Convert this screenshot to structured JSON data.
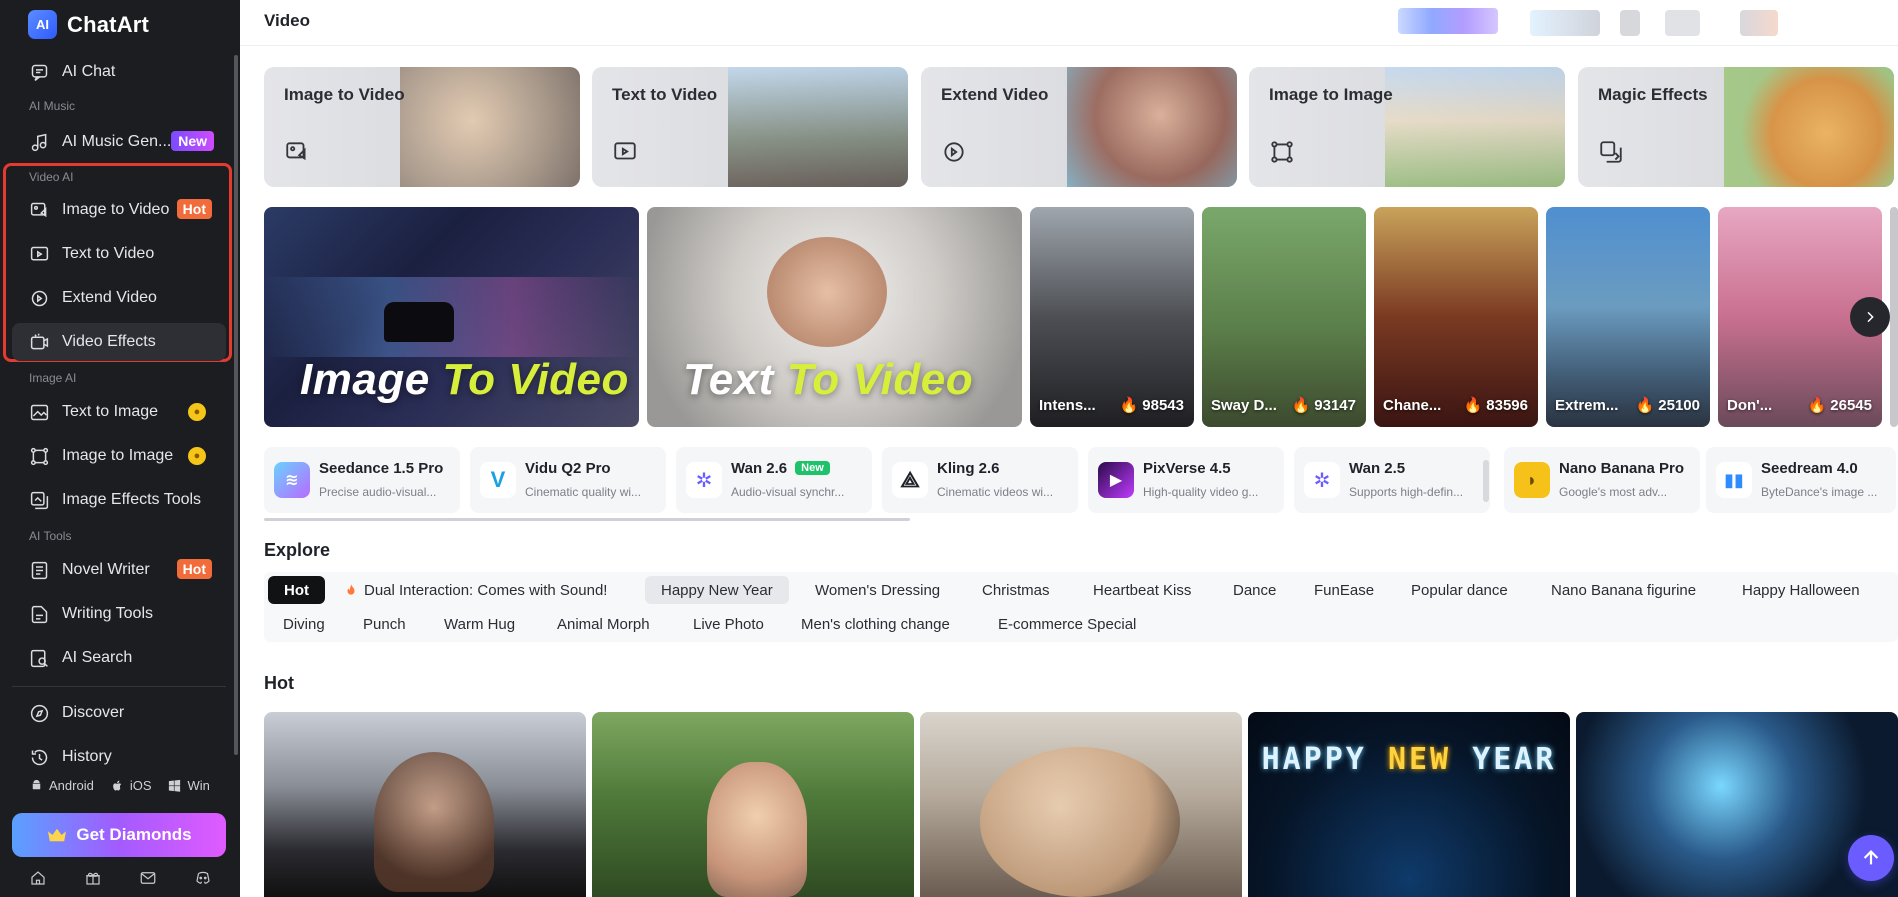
{
  "brand": {
    "logo_text": "AI",
    "name": "ChatArt"
  },
  "sidebar": {
    "items": [
      {
        "label": "AI Chat"
      },
      {
        "label": "AI Music Gen...",
        "badge": "New"
      },
      {
        "label": "Image to Video",
        "badge": "Hot"
      },
      {
        "label": "Text to Video"
      },
      {
        "label": "Extend Video"
      },
      {
        "label": "Video Effects"
      },
      {
        "label": "Text to Image"
      },
      {
        "label": "Image to Image"
      },
      {
        "label": "Image Effects Tools"
      },
      {
        "label": "Novel Writer",
        "badge": "Hot"
      },
      {
        "label": "Writing Tools"
      },
      {
        "label": "AI Search"
      },
      {
        "label": "Discover"
      },
      {
        "label": "History"
      }
    ],
    "sections": {
      "music": "AI Music",
      "video": "Video AI",
      "image": "Image AI",
      "tools": "AI Tools"
    },
    "platforms": {
      "android": "Android",
      "ios": "iOS",
      "win": "Win"
    },
    "cta": "Get Diamonds"
  },
  "header": {
    "title": "Video"
  },
  "features": [
    {
      "label": "Image to Video"
    },
    {
      "label": "Text to Video"
    },
    {
      "label": "Extend Video"
    },
    {
      "label": "Image to Image"
    },
    {
      "label": "Magic Effects"
    }
  ],
  "banners": [
    {
      "part1": "Image ",
      "part2": "To Video"
    },
    {
      "part1": "Text ",
      "part2": "To Video"
    }
  ],
  "effects": [
    {
      "name": "Intens...",
      "count": "🔥 98543"
    },
    {
      "name": "Sway D...",
      "count": "🔥 93147"
    },
    {
      "name": "Chane...",
      "count": "🔥 83596"
    },
    {
      "name": "Extrem...",
      "count": "🔥 25100"
    },
    {
      "name": "Don'...",
      "count": "🔥 26545"
    }
  ],
  "models": [
    {
      "name": "Seedance 1.5 Pro",
      "desc": "Precise audio-visual...",
      "color": "#8a5cff"
    },
    {
      "name": "Vidu Q2 Pro",
      "desc": "Cinematic quality wi...",
      "color": "#1aa0e6"
    },
    {
      "name": "Wan 2.6",
      "badge": "New",
      "desc": "Audio-visual synchr...",
      "color": "#6a5cff"
    },
    {
      "name": "Kling 2.6",
      "desc": "Cinematic videos wi...",
      "color": "#1f2329"
    },
    {
      "name": "PixVerse 4.5",
      "desc": "High-quality video g...",
      "color": "#7b3bff"
    },
    {
      "name": "Wan 2.5",
      "desc": "Supports high-defin...",
      "color": "#6a5cff"
    },
    {
      "name": "Nano Banana Pro",
      "desc": "Google's most adv...",
      "color": "#f6c21a"
    },
    {
      "name": "Seedream 4.0",
      "desc": "ByteDance's image ...",
      "color": "#2f8cff"
    }
  ],
  "explore": {
    "title": "Explore",
    "row1": [
      "Hot",
      "Dual Interaction: Comes with Sound!",
      "Happy New Year",
      "Women's Dressing",
      "Christmas",
      "Heartbeat Kiss",
      "Dance",
      "FunEase",
      "Popular dance",
      "Nano Banana figurine",
      "Happy Halloween"
    ],
    "row2": [
      "Diving",
      "Punch",
      "Warm Hug",
      "Animal Morph",
      "Live Photo",
      "Men's clothing change",
      "E-commerce Special"
    ]
  },
  "hot": {
    "title": "Hot",
    "card4_text": {
      "w1": "HAPPY ",
      "w2": "NEW ",
      "w3": "YEAR"
    }
  }
}
